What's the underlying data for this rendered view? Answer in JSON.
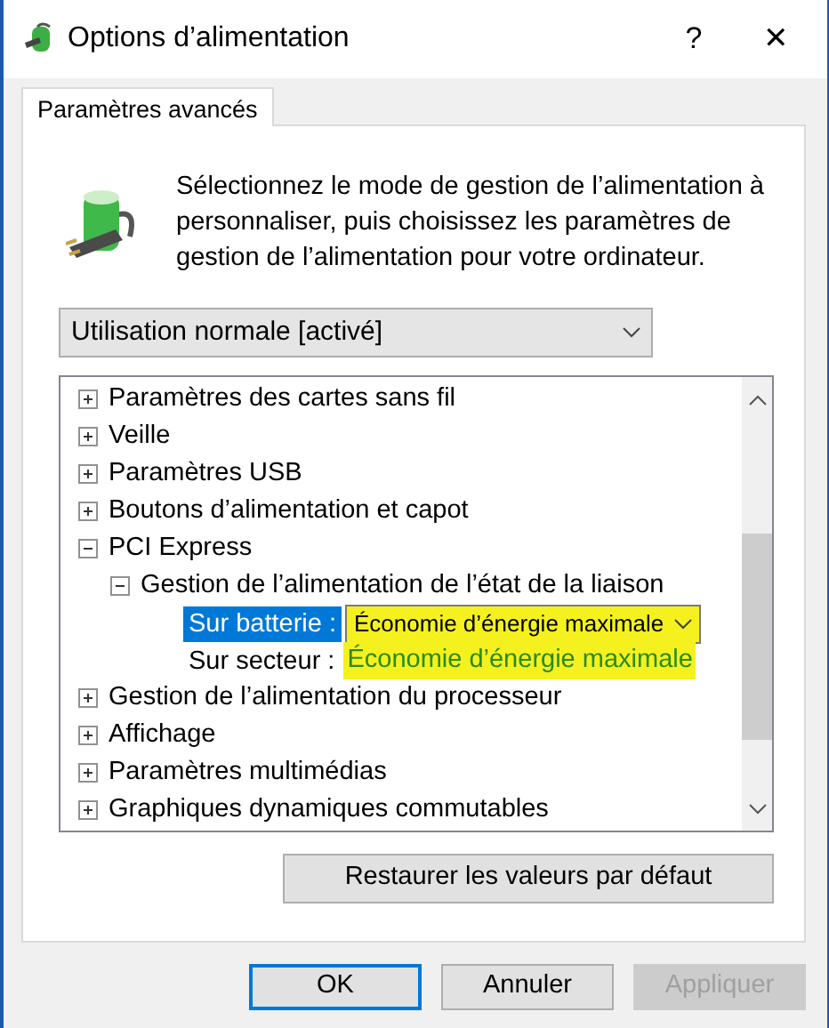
{
  "window": {
    "title": "Options d’alimentation",
    "help": "?",
    "close": "✕"
  },
  "tabs": [
    {
      "label": "Paramètres avancés",
      "selected": true
    }
  ],
  "description": "Sélectionnez le mode de gestion de l’alimentation à personnaliser, puis choisissez les paramètres de gestion de l’alimentation pour votre ordinateur.",
  "plan_select": {
    "value": "Utilisation normale [activé]"
  },
  "tree": [
    {
      "label": "Paramètres des cartes sans fil",
      "expanded": false
    },
    {
      "label": "Veille",
      "expanded": false
    },
    {
      "label": "Paramètres USB",
      "expanded": false
    },
    {
      "label": "Boutons d’alimentation et capot",
      "expanded": false
    },
    {
      "label": "PCI Express",
      "expanded": true,
      "children": [
        {
          "label": "Gestion de l’alimentation de l’état de la liaison",
          "expanded": true,
          "settings": [
            {
              "kind": "dropdown",
              "label": "Sur batterie :",
              "value": "Économie d’énergie maximale",
              "selected": true,
              "highlighted": true
            },
            {
              "kind": "value",
              "label": "Sur secteur :",
              "value": "Économie d’énergie maximale",
              "selected": false,
              "highlighted": true
            }
          ]
        }
      ]
    },
    {
      "label": "Gestion de l’alimentation du processeur",
      "expanded": false
    },
    {
      "label": "Affichage",
      "expanded": false
    },
    {
      "label": "Paramètres multimédias",
      "expanded": false
    },
    {
      "label": "Graphiques dynamiques commutables",
      "expanded": false
    }
  ],
  "restore_button": "Restaurer les valeurs par défaut",
  "buttons": [
    {
      "label": "OK",
      "default": true,
      "disabled": false
    },
    {
      "label": "Annuler",
      "default": false,
      "disabled": false
    },
    {
      "label": "Appliquer",
      "default": false,
      "disabled": true
    }
  ]
}
